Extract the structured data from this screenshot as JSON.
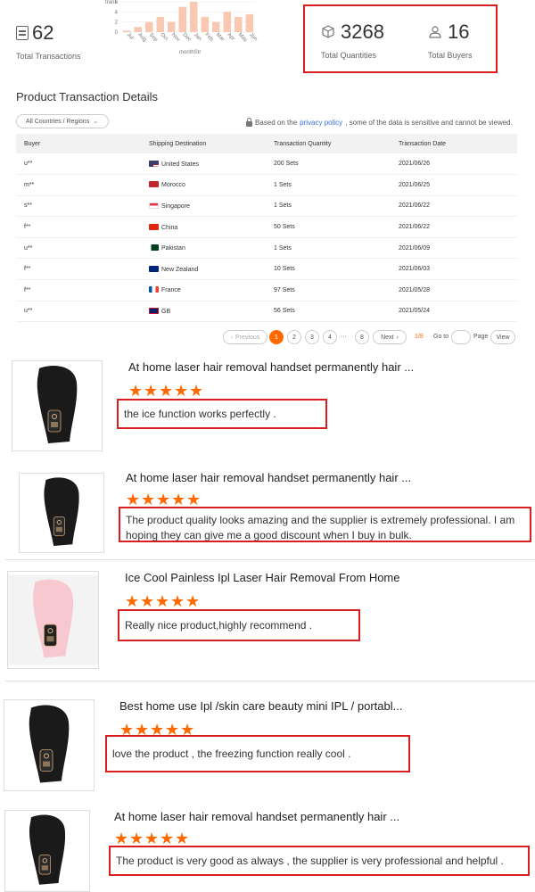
{
  "stats": {
    "total_transactions_value": "62",
    "total_transactions_label": "Total Transactions",
    "total_quantities_value": "3268",
    "total_quantities_label": "Total Quantities",
    "total_buyers_value": "16",
    "total_buyers_label": "Total Buyers"
  },
  "chart_data": {
    "type": "bar",
    "ylabel": "trans",
    "xlabel": "monthStr",
    "categories": [
      "Jul",
      "Aug",
      "Sep",
      "Oct",
      "Nov",
      "Dec",
      "Jan",
      "Feb",
      "Mar",
      "Apr",
      "May",
      "Jun"
    ],
    "values": [
      0.3,
      1,
      2,
      3,
      2,
      5,
      6,
      3,
      2,
      4,
      3,
      3.5
    ],
    "ytick_labels": [
      "6",
      "4",
      "2",
      "0"
    ],
    "ylim": [
      0,
      6
    ],
    "bar_color": "#f8c8b0",
    "grid": true
  },
  "details": {
    "title": "Product Transaction Details",
    "region_select": "All Countries / Regions",
    "privacy_prefix": "Based on the",
    "privacy_link": "privacy policy",
    "privacy_suffix": ", some of the data is sensitive and cannot be viewed.",
    "headers": [
      "Buyer",
      "Shipping Destination",
      "Transaction Quantity",
      "Transaction Date"
    ],
    "rows": [
      {
        "buyer": "u**",
        "country": "United States",
        "flag": "us",
        "qty": "200 Sets",
        "date": "2021/06/26"
      },
      {
        "buyer": "m**",
        "country": "Morocco",
        "flag": "ma",
        "qty": "1 Sets",
        "date": "2021/06/25"
      },
      {
        "buyer": "s**",
        "country": "Singapore",
        "flag": "sg",
        "qty": "1 Sets",
        "date": "2021/06/22"
      },
      {
        "buyer": "f**",
        "country": "China",
        "flag": "cn",
        "qty": "50 Sets",
        "date": "2021/06/22"
      },
      {
        "buyer": "u**",
        "country": "Pakistan",
        "flag": "pk",
        "qty": "1 Sets",
        "date": "2021/06/09"
      },
      {
        "buyer": "f**",
        "country": "New Zealand",
        "flag": "nz",
        "qty": "10 Sets",
        "date": "2021/06/03"
      },
      {
        "buyer": "f**",
        "country": "France",
        "flag": "fr",
        "qty": "97 Sets",
        "date": "2021/05/28"
      },
      {
        "buyer": "u**",
        "country": "GB",
        "flag": "gb",
        "qty": "56 Sets",
        "date": "2021/05/24"
      }
    ],
    "pagination": {
      "previous": "Previous",
      "pages": [
        "1",
        "2",
        "3",
        "4"
      ],
      "ellipsis": "···",
      "last": "8",
      "next": "Next",
      "page_count": "1/8",
      "goto": "Go to",
      "page": "Page",
      "view": "View"
    }
  },
  "colors": {
    "accent": "#ff6a00",
    "highlight_border": "#d81e1e",
    "link": "#3a6fd8"
  },
  "reviews": [
    {
      "title": "At home laser hair removal handset permanently hair ...",
      "rating": 5,
      "comment": "the ice function works perfectly .",
      "device_color": "black"
    },
    {
      "title": "At home laser hair removal handset permanently hair ...",
      "rating": 5,
      "comment": "The product quality looks amazing and the supplier is extremely professional. I am hoping they can give me a good discount when I buy in bulk.",
      "device_color": "black"
    },
    {
      "title": "Ice Cool Painless Ipl Laser Hair Removal From Home",
      "rating": 5,
      "comment": "Really nice product,highly recommend .",
      "device_color": "pink"
    },
    {
      "title": "Best home use Ipl /skin care beauty mini IPL / portabl...",
      "rating": 5,
      "comment": "love the product , the freezing function really cool .",
      "device_color": "black"
    },
    {
      "title": "At home laser hair removal handset permanently hair ...",
      "rating": 5,
      "comment": "The product is very good as always , the supplier is very professional and helpful .",
      "device_color": "black"
    }
  ]
}
